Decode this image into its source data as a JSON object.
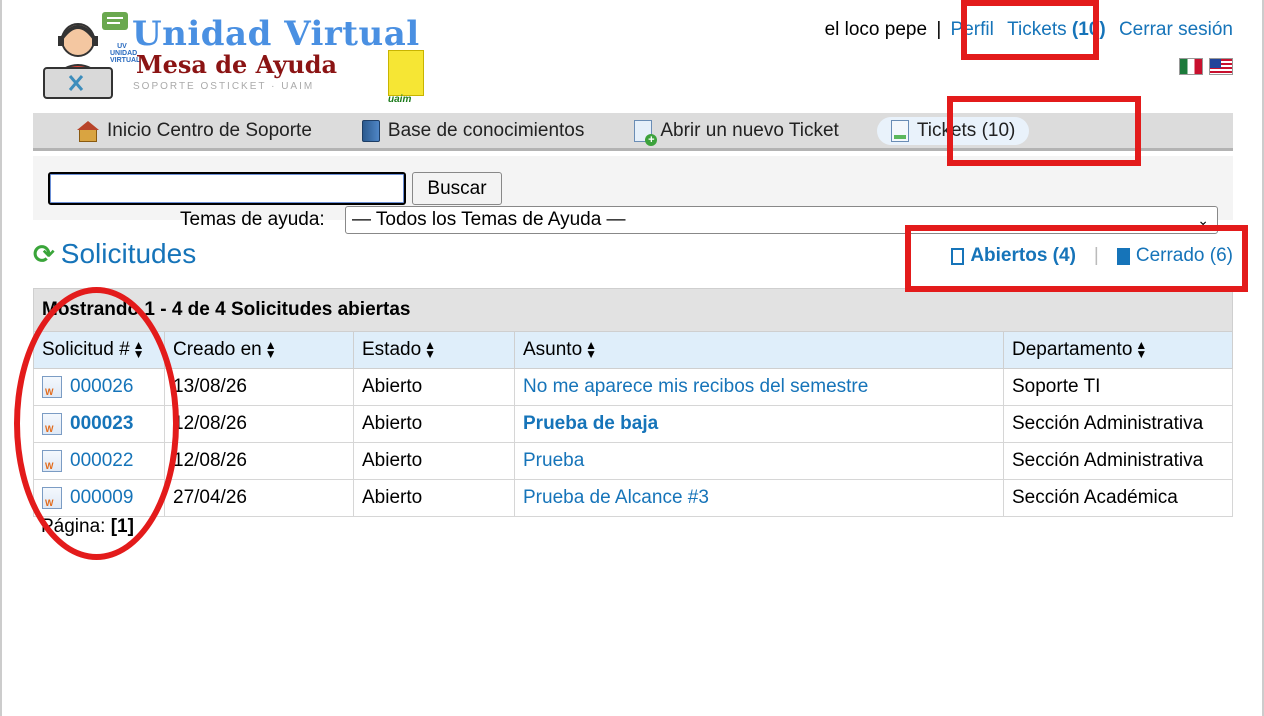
{
  "header": {
    "logo_title": "Unidad Virtual",
    "logo_subtitle": "Mesa de Ayuda",
    "logo_tagline": "SOPORTE OSTICKET · UAIM",
    "uv_mark": "UV UNIDAD VIRTUAL",
    "uaim_label": "uaim",
    "user_name": "el loco pepe",
    "separator": "|",
    "profile_link": "Perfil",
    "tickets_link": "Tickets",
    "tickets_count": "(10)",
    "logout_link": "Cerrar sesión",
    "flags": [
      "mexico-flag-icon",
      "usa-flag-icon"
    ]
  },
  "nav": {
    "items": [
      {
        "label": "Inicio Centro de Soporte",
        "icon": "home-icon"
      },
      {
        "label": "Base de conocimientos",
        "icon": "book-icon"
      },
      {
        "label": "Abrir un nuevo Ticket",
        "icon": "new-ticket-icon"
      },
      {
        "label": "Tickets (10)",
        "icon": "tickets-icon",
        "active": true
      }
    ]
  },
  "search": {
    "input_value": "",
    "button_label": "Buscar",
    "topics_label": "Temas de ayuda:",
    "topics_selected": "— Todos los Temas de Ayuda —"
  },
  "main": {
    "title": "Solicitudes",
    "filter_open": "Abiertos (4)",
    "filter_divider": "|",
    "filter_closed": "Cerrado (6)",
    "table_caption": "Mostrando 1 - 4 de 4 Solicitudes abiertas",
    "columns": [
      "Solicitud #",
      "Creado en",
      "Estado",
      "Asunto",
      "Departamento"
    ],
    "rows": [
      {
        "number": "000026",
        "created": "13/08/26",
        "status": "Abierto",
        "subject": "No me aparece mis recibos del semestre",
        "department": "Soporte TI",
        "bold": false
      },
      {
        "number": "000023",
        "created": "12/08/26",
        "status": "Abierto",
        "subject": "Prueba de baja",
        "department": "Sección Administrativa",
        "bold": true
      },
      {
        "number": "000022",
        "created": "12/08/26",
        "status": "Abierto",
        "subject": "Prueba",
        "department": "Sección Administrativa",
        "bold": false
      },
      {
        "number": "000009",
        "created": "27/04/26",
        "status": "Abierto",
        "subject": "Prueba de Alcance #3",
        "department": "Sección Académica",
        "bold": false
      }
    ],
    "pagination_label": "Página:",
    "pagination_current": "[1]"
  },
  "colors": {
    "link": "#1674b9",
    "annotation": "#e31b1b",
    "header_row_bg": "#dfeefa"
  }
}
